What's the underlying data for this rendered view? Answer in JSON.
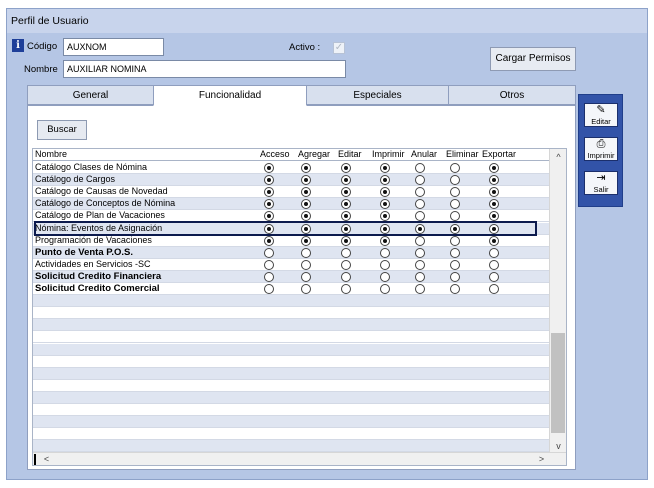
{
  "window": {
    "title": "Perfil de Usuario"
  },
  "form": {
    "codigo_label": "Código",
    "codigo_value": "AUXNOM",
    "nombre_label": "Nombre",
    "nombre_value": "AUXILIAR NOMINA",
    "activo_label": "Activo :",
    "cargar_label": "Cargar Permisos"
  },
  "tabs": [
    {
      "label": "General"
    },
    {
      "label": "Funcionalidad"
    },
    {
      "label": "Especiales"
    },
    {
      "label": "Otros"
    }
  ],
  "panel": {
    "buscar_label": "Buscar"
  },
  "grid": {
    "columns": [
      "Nombre",
      "Acceso",
      "Agregar",
      "Editar",
      "Imprimir",
      "Anular",
      "Eliminar",
      "Exportar"
    ],
    "rows": [
      {
        "name": "Catálogo Clases de Nómina",
        "bold": false,
        "values": [
          1,
          1,
          1,
          1,
          0,
          0,
          1
        ]
      },
      {
        "name": "Catálogo de Cargos",
        "bold": false,
        "values": [
          1,
          1,
          1,
          1,
          0,
          0,
          1
        ]
      },
      {
        "name": "Catálogo de Causas de Novedad",
        "bold": false,
        "values": [
          1,
          1,
          1,
          1,
          0,
          0,
          1
        ]
      },
      {
        "name": "Catálogo de Conceptos de Nómina",
        "bold": false,
        "values": [
          1,
          1,
          1,
          1,
          0,
          0,
          1
        ]
      },
      {
        "name": "Catálogo de Plan de Vacaciones",
        "bold": false,
        "values": [
          1,
          1,
          1,
          1,
          0,
          0,
          1
        ]
      },
      {
        "name": "Nómina: Eventos de Asignación",
        "bold": false,
        "values": [
          1,
          1,
          1,
          1,
          1,
          1,
          1
        ]
      },
      {
        "name": "Programación de Vacaciones",
        "bold": false,
        "values": [
          1,
          1,
          1,
          1,
          0,
          0,
          1
        ]
      },
      {
        "name": "Punto de Venta P.O.S.",
        "bold": true,
        "values": [
          0,
          0,
          0,
          0,
          0,
          0,
          0
        ]
      },
      {
        "name": "Actividades en Servicios -SC",
        "bold": false,
        "values": [
          0,
          0,
          0,
          0,
          0,
          0,
          0
        ]
      },
      {
        "name": "Solicitud Credito Financiera",
        "bold": true,
        "values": [
          0,
          0,
          0,
          0,
          0,
          0,
          0
        ]
      },
      {
        "name": "Solicitud Credito Comercial",
        "bold": true,
        "values": [
          0,
          0,
          0,
          0,
          0,
          0,
          0
        ]
      }
    ],
    "selected_row": 5
  },
  "sidebar": {
    "editar_label": "Editar",
    "imprimir_label": "Imprimir",
    "salir_label": "Salir"
  }
}
